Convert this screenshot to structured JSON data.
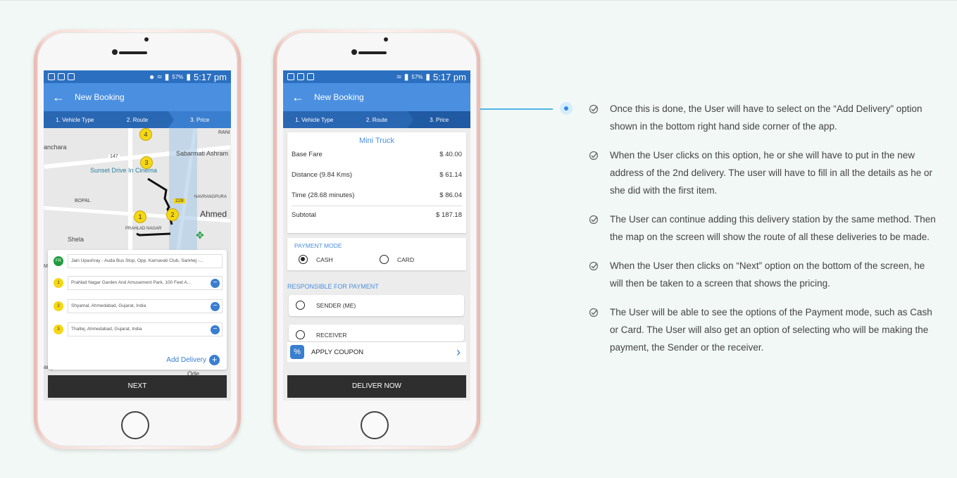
{
  "left_phone": {
    "status": {
      "battery": "57%",
      "time": "5:17 pm"
    },
    "appbar_title": "New Booking",
    "steps": [
      "1. Vehicle Type",
      "2. Route",
      "3. Price"
    ],
    "map_labels": [
      "RANI",
      "anchara",
      "Sabarmati Ashram",
      "Sunset Drive In Cinema",
      "BOPAL",
      "NAVRANGPURA",
      "Ahmed",
      "PRAHLAD NAGAR",
      "Shela",
      "Ma",
      "angoda",
      "Ode",
      "147",
      "228"
    ],
    "pins": [
      "4",
      "3",
      "2",
      "1"
    ],
    "addresses": [
      {
        "badge": "FR",
        "text": "Jain Upashray - Auda Bus Stop, Opp. Karnavati Club, Sarkhej -..."
      },
      {
        "badge": "1",
        "text": "Prahlad Nagar Garden And Amusement Park, 100 Feet A..."
      },
      {
        "badge": "2",
        "text": "Shyamal, Ahmedabad, Gujarat, India"
      },
      {
        "badge": "3",
        "text": "Thaltej, Ahmedabad, Gujarat, India"
      }
    ],
    "add_delivery": "Add Delivery",
    "next_button": "NEXT"
  },
  "right_phone": {
    "status": {
      "battery": "57%",
      "time": "5:17 pm"
    },
    "appbar_title": "New Booking",
    "steps": [
      "1. Vehicle Type",
      "2. Route",
      "3. Price"
    ],
    "vehicle": "Mini Truck",
    "fares": [
      {
        "label": "Base Fare",
        "value": "$ 40.00"
      },
      {
        "label": "Distance (9.84 Kms)",
        "value": "$ 61.14"
      },
      {
        "label": "Time (28.68 minutes)",
        "value": "$ 86.04"
      },
      {
        "label": "Subtotal",
        "value": "$ 187.18"
      }
    ],
    "payment_mode_label": "PAYMENT MODE",
    "payment_options": [
      "CASH",
      "CARD"
    ],
    "responsible_label": "RESPONSIBLE FOR PAYMENT",
    "responsible_options": [
      "SENDER (ME)",
      "RECEIVER"
    ],
    "coupon": {
      "badge": "%",
      "label": "APPLY COUPON"
    },
    "deliver_button": "DELIVER NOW"
  },
  "points": [
    "Once this is done, the User will have to select on the “Add Delivery” option shown in the bottom right hand side corner of the app.",
    "When the User clicks on this option, he or she will have to put in the new address of the 2nd delivery. The user will have to fill in all the details as he or she did with the first item.",
    "The User can continue adding this delivery station by the same method. Then the map on the screen will show the route of all these deliveries to be made.",
    "When the User then clicks on “Next” option on the bottom of the screen, he will then be taken to a screen that shows the pricing.",
    "The User will be able to see the options of the Payment mode, such as Cash or Card. The User will also get an option of selecting who will be making the payment, the Sender or the receiver."
  ],
  "colors": {
    "accent": "#4a8fe0",
    "statusbar": "#2b6fc0",
    "dark_button": "#2e2e2e",
    "pin": "#f5d714",
    "from_badge": "#1e9b3c"
  }
}
